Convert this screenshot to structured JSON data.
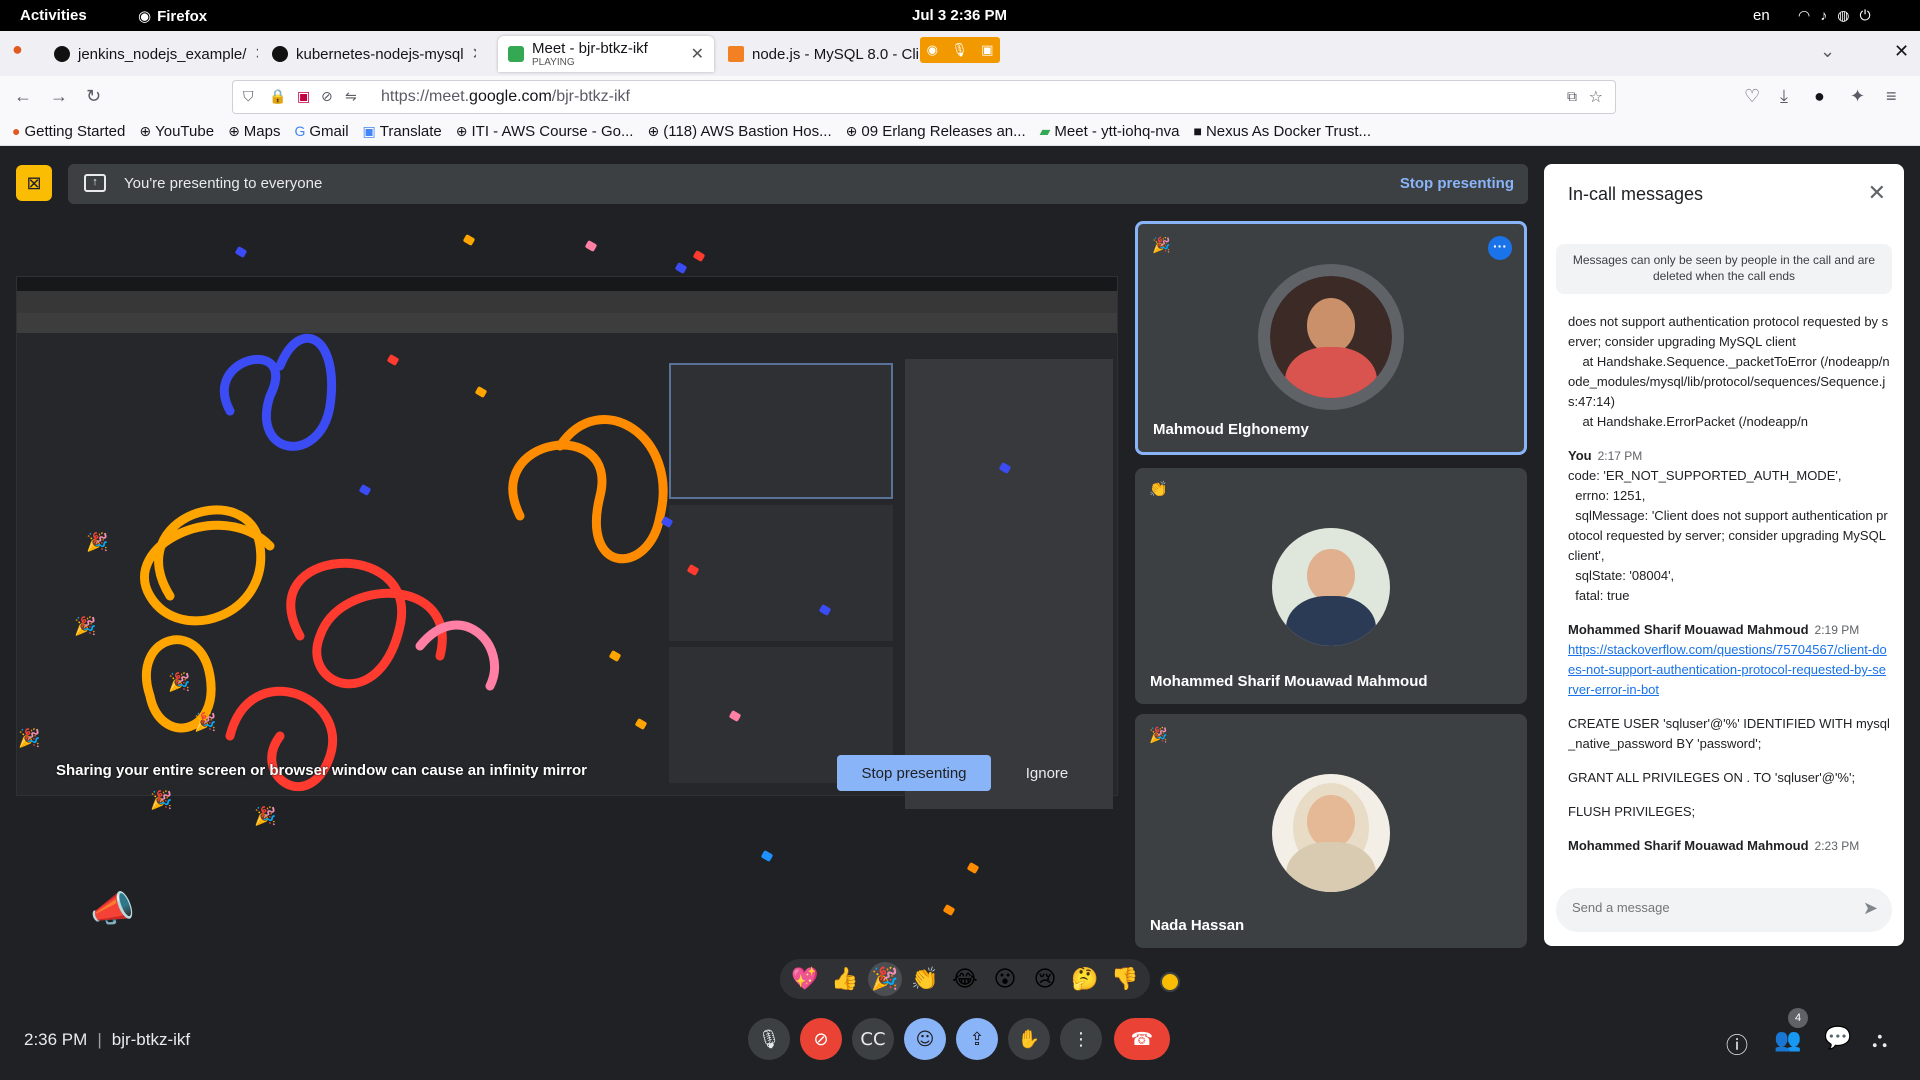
{
  "system": {
    "activities": "Activities",
    "app": "Firefox",
    "clock": "Jul 3  2:36 PM",
    "lang": "en"
  },
  "tabs": [
    {
      "title": "jenkins_nodejs_example/",
      "sub": ""
    },
    {
      "title": "kubernetes-nodejs-mysql",
      "sub": ""
    },
    {
      "title": "Meet - bjr-btkz-ikf",
      "sub": "PLAYING"
    },
    {
      "title": "node.js - MySQL 8.0 - Cli",
      "sub": ""
    }
  ],
  "url": {
    "prefix": "https://meet.",
    "domain": "google.com",
    "path": "/bjr-btkz-ikf"
  },
  "bookmarks": [
    "Getting Started",
    "YouTube",
    "Maps",
    "Gmail",
    "Translate",
    "ITI - AWS Course - Go...",
    "(118) AWS Bastion Hos...",
    "09 Erlang Releases an...",
    "Meet - ytt-iohq-nva",
    "Nexus As Docker Trust..."
  ],
  "banner": {
    "text": "You're presenting to everyone",
    "stop": "Stop presenting"
  },
  "mirror_warning": "Sharing your entire screen or browser window can cause an infinity mirror",
  "warning_buttons": {
    "stop": "Stop presenting",
    "ignore": "Ignore"
  },
  "participants": [
    {
      "name": "Mahmoud Elghonemy",
      "reaction": "🎉"
    },
    {
      "name": "Mohammed Sharif Mouawad Mahmoud",
      "reaction": "👏"
    },
    {
      "name": "Nada Hassan",
      "reaction": "🎉"
    }
  ],
  "chat": {
    "title": "In-call messages",
    "notice": "Messages can only be seen by people in the call and are deleted when the call ends",
    "messages": [
      {
        "sender": "",
        "time": "",
        "body": "does not support authentication protocol requested by server; consider upgrading MySQL client\n    at Handshake.Sequence._packetToError (/nodeapp/node_modules/mysql/lib/protocol/sequences/Sequence.js:47:14)\n    at Handshake.ErrorPacket (/nodeapp/n",
        "link": ""
      },
      {
        "sender": "You",
        "time": "2:17 PM",
        "body": "code: 'ER_NOT_SUPPORTED_AUTH_MODE',\n  errno: 1251,\n  sqlMessage: 'Client does not support authentication protocol requested by server; consider upgrading MySQL client',\n  sqlState: '08004',\n  fatal: true",
        "link": ""
      },
      {
        "sender": "Mohammed Sharif Mouawad Mahmoud",
        "time": "2:19 PM",
        "body": "",
        "link": "https://stackoverflow.com/questions/75704567/client-does-not-support-authentication-protocol-requested-by-server-error-in-bot"
      },
      {
        "sender": "",
        "time": "",
        "body": "CREATE USER 'sqluser'@'%' IDENTIFIED WITH mysql_native_password BY 'password';",
        "link": ""
      },
      {
        "sender": "",
        "time": "",
        "body": "GRANT ALL PRIVILEGES ON . TO 'sqluser'@'%';",
        "link": ""
      },
      {
        "sender": "",
        "time": "",
        "body": "FLUSH PRIVILEGES;",
        "link": ""
      },
      {
        "sender": "Mohammed Sharif Mouawad Mahmoud",
        "time": "2:23 PM",
        "body": "",
        "link": ""
      }
    ],
    "input_placeholder": "Send a message"
  },
  "reactions": [
    "💖",
    "👍",
    "🎉",
    "👏",
    "😂",
    "😮",
    "😢",
    "🤔",
    "👎"
  ],
  "footer": {
    "time": "2:36 PM",
    "meeting_code": "bjr-btkz-ikf",
    "people_count": "4"
  },
  "colors": {
    "accent": "#8ab4f8",
    "danger": "#ea4335",
    "present": "#fbbc04",
    "bg": "#202124"
  }
}
